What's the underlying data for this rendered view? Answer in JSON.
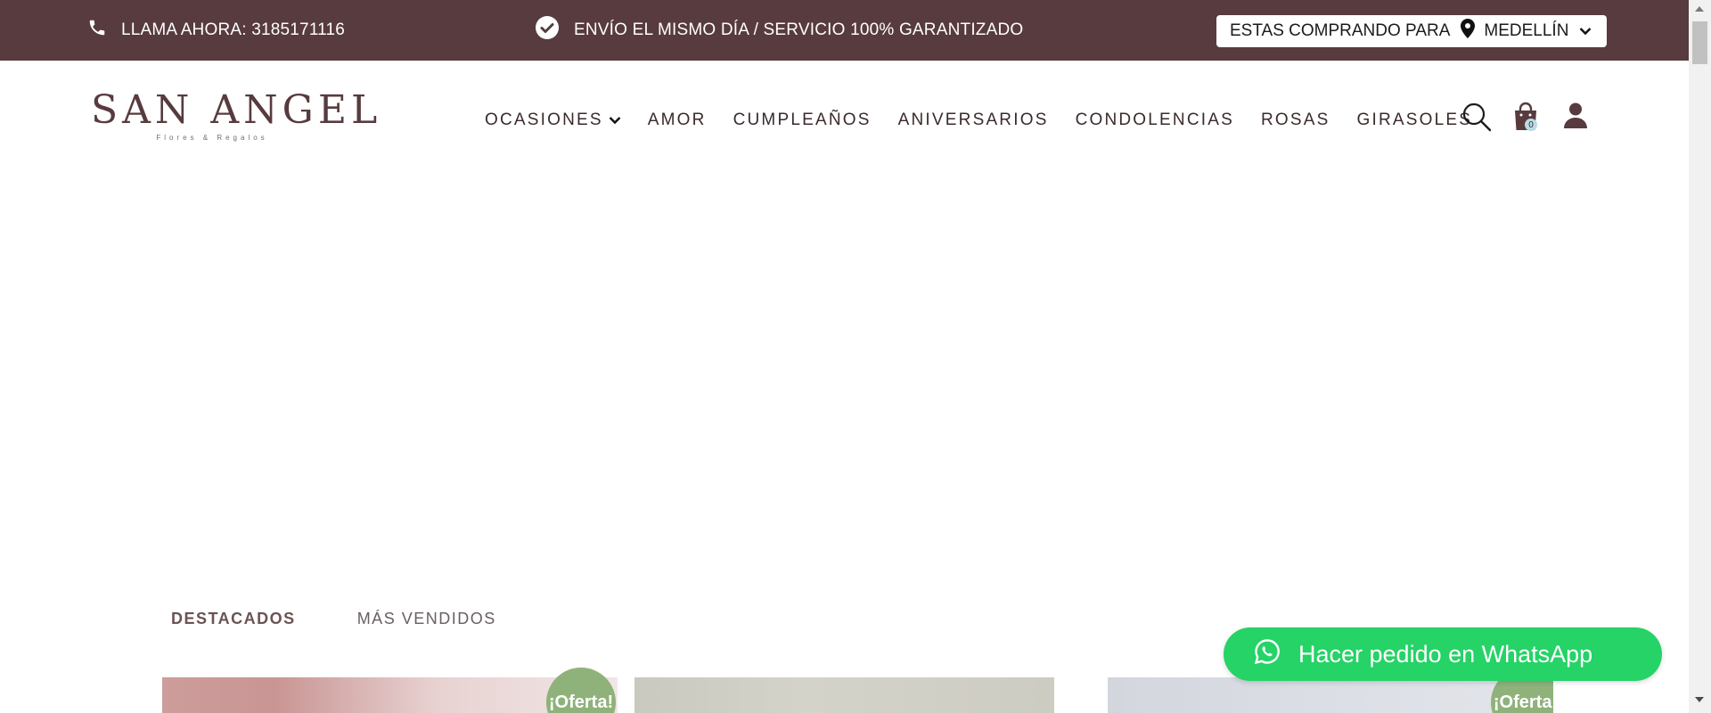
{
  "topbar": {
    "call_label": "LLAMA AHORA: 3185171116",
    "shipping_label": "ENVÍO EL MISMO DÍA / SERVICIO 100% GARANTIZADO",
    "city_prefix": "ESTAS COMPRANDO PARA",
    "city": "MEDELLÍN",
    "background": "#583b3e"
  },
  "logo": {
    "title": "SAN ANGEL",
    "subtitle": "Flores & Regalos"
  },
  "nav": {
    "items": [
      {
        "label": "OCASIONES",
        "dropdown": true
      },
      {
        "label": "AMOR"
      },
      {
        "label": "CUMPLEAÑOS"
      },
      {
        "label": "ANIVERSARIOS"
      },
      {
        "label": "CONDOLENCIAS"
      },
      {
        "label": "ROSAS"
      },
      {
        "label": "GIRASOLES"
      }
    ]
  },
  "header_icons": {
    "search": "search-icon",
    "cart": "shopping-bag-icon",
    "cart_count": "0",
    "account": "user-icon"
  },
  "tabs": [
    {
      "label": "DESTACADOS",
      "active": true
    },
    {
      "label": "MÁS VENDIDOS",
      "active": false
    }
  ],
  "products": {
    "badge_label": "¡Oferta!"
  },
  "whatsapp": {
    "label": "Hacer pedido en WhatsApp",
    "color": "#25d366"
  }
}
